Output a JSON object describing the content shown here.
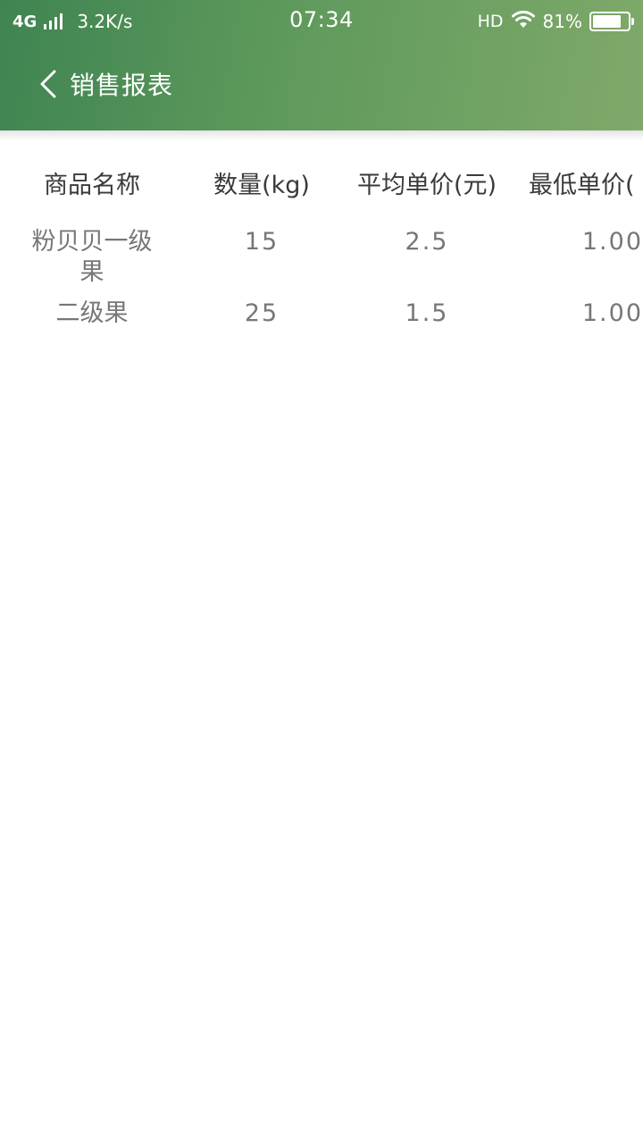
{
  "status_bar": {
    "network": "4G",
    "speed": "3.2K/s",
    "time": "07:34",
    "hd": "HD",
    "battery": "81%",
    "battery_level": 0.81
  },
  "title_bar": {
    "back_icon": "chevron-left-icon",
    "title": "销售报表"
  },
  "table": {
    "headers": [
      "商品名称",
      "数量(kg)",
      "平均单价(元)",
      "最低单价("
    ],
    "rows": [
      {
        "name": "粉贝贝一级果",
        "quantity": "15",
        "avg_price": "2.5",
        "min_price": "1.00"
      },
      {
        "name": "二级果",
        "quantity": "25",
        "avg_price": "1.5",
        "min_price": "1.00"
      }
    ]
  },
  "colors": {
    "header_gradient_start": "#3f8452",
    "header_gradient_end": "#7fa96a",
    "header_text": "#3a3a3a",
    "cell_text": "#777777"
  }
}
